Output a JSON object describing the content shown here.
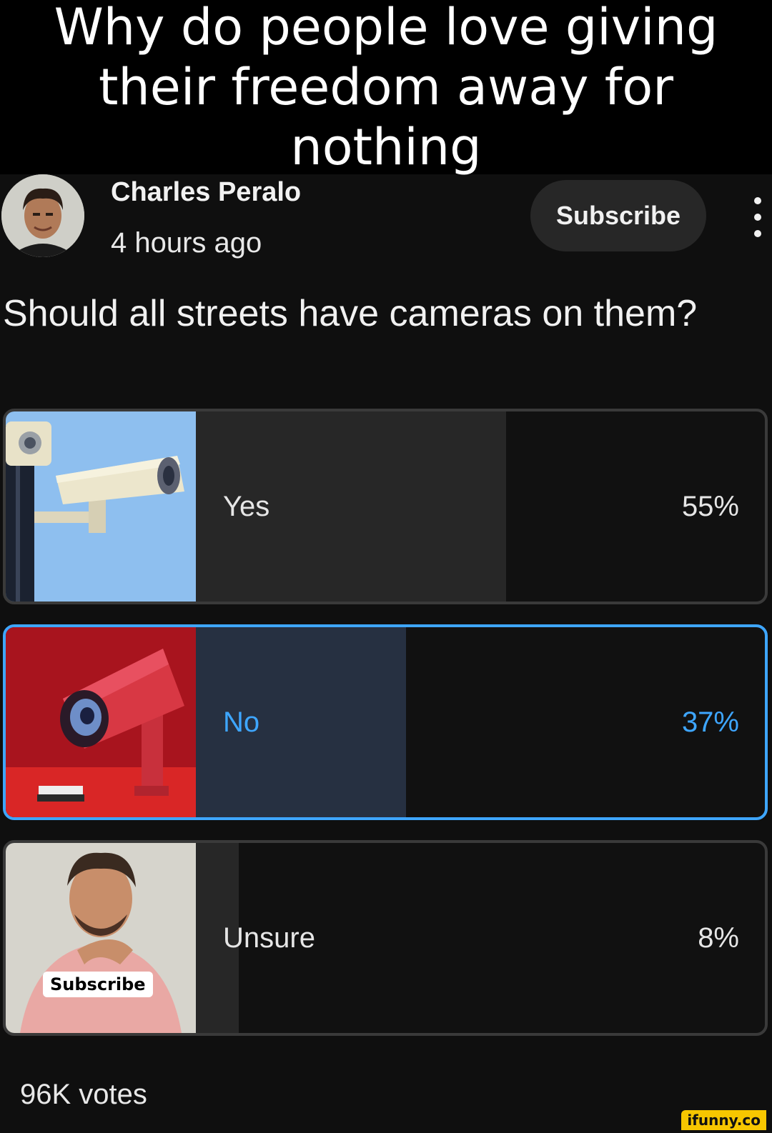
{
  "caption": "Why do people love giving their freedom away for nothing",
  "post": {
    "channel_name": "Charles Peralo",
    "time_ago": "4 hours ago",
    "subscribe_label": "Subscribe",
    "question": "Should all streets have cameras on them?",
    "votes": "96K votes"
  },
  "poll": {
    "options": [
      {
        "label": "Yes",
        "percent_text": "55%",
        "percent": 55,
        "selected": false,
        "image_icon": "security-camera-sky"
      },
      {
        "label": "No",
        "percent_text": "37%",
        "percent": 37,
        "selected": true,
        "image_icon": "red-security-camera"
      },
      {
        "label": "Unsure",
        "percent_text": "8%",
        "percent": 8,
        "selected": false,
        "image_icon": "man-thinking-photo"
      }
    ],
    "unsure_image_badge": "Subscribe"
  },
  "colors": {
    "accent": "#3ea6ff",
    "background": "#0f0f0f",
    "fill": "#272727",
    "selected_fill": "#263041"
  },
  "watermark": "ifunny.co"
}
